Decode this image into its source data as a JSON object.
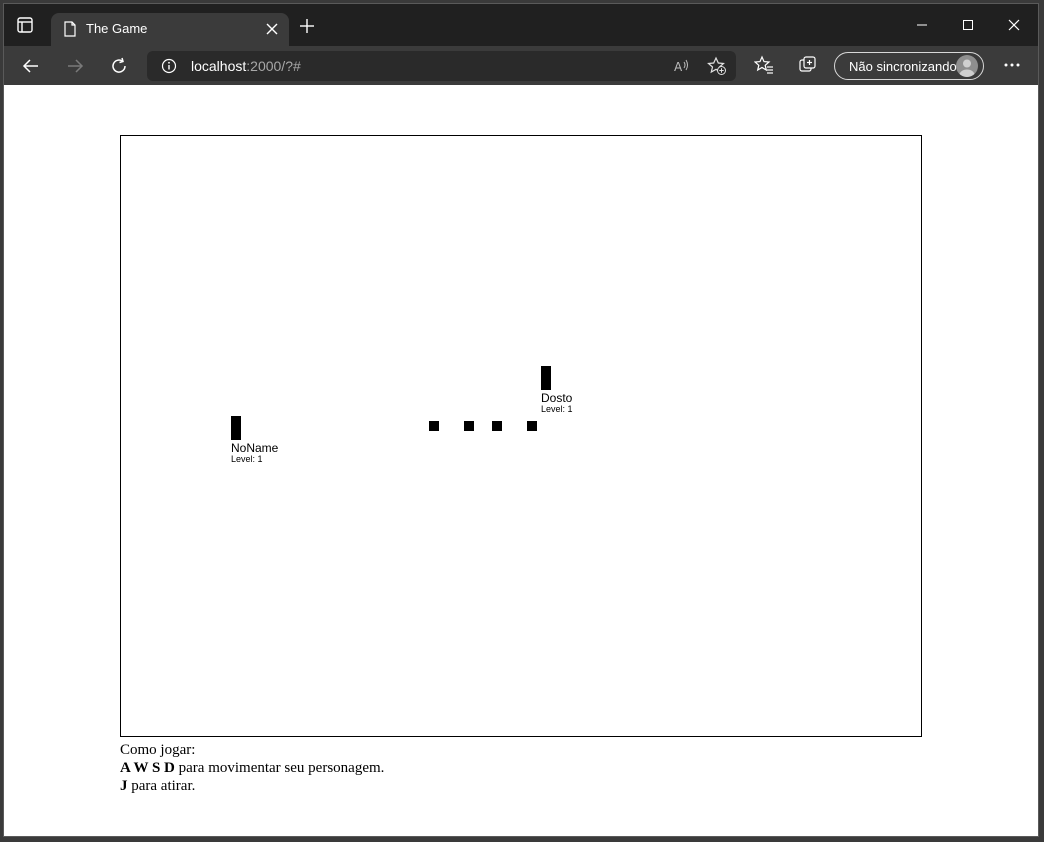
{
  "browser": {
    "tab_title": "The Game",
    "url_host": "localhost",
    "url_rest": ":2000/?#",
    "sync_label": "Não sincronizando",
    "colors": {
      "titlebar": "#202020",
      "toolbar": "#3b3b3b",
      "tab": "#3b3b3b"
    }
  },
  "game": {
    "players": [
      {
        "name": "NoName",
        "level": "Level: 1"
      },
      {
        "name": "Dosto",
        "level": "Level: 1"
      }
    ],
    "bullet_count": 4
  },
  "instructions": {
    "heading": "Como jogar:",
    "move_keys": "A W S D",
    "move_text": " para movimentar seu personagem.",
    "shoot_key": "J",
    "shoot_text": " para atirar."
  }
}
